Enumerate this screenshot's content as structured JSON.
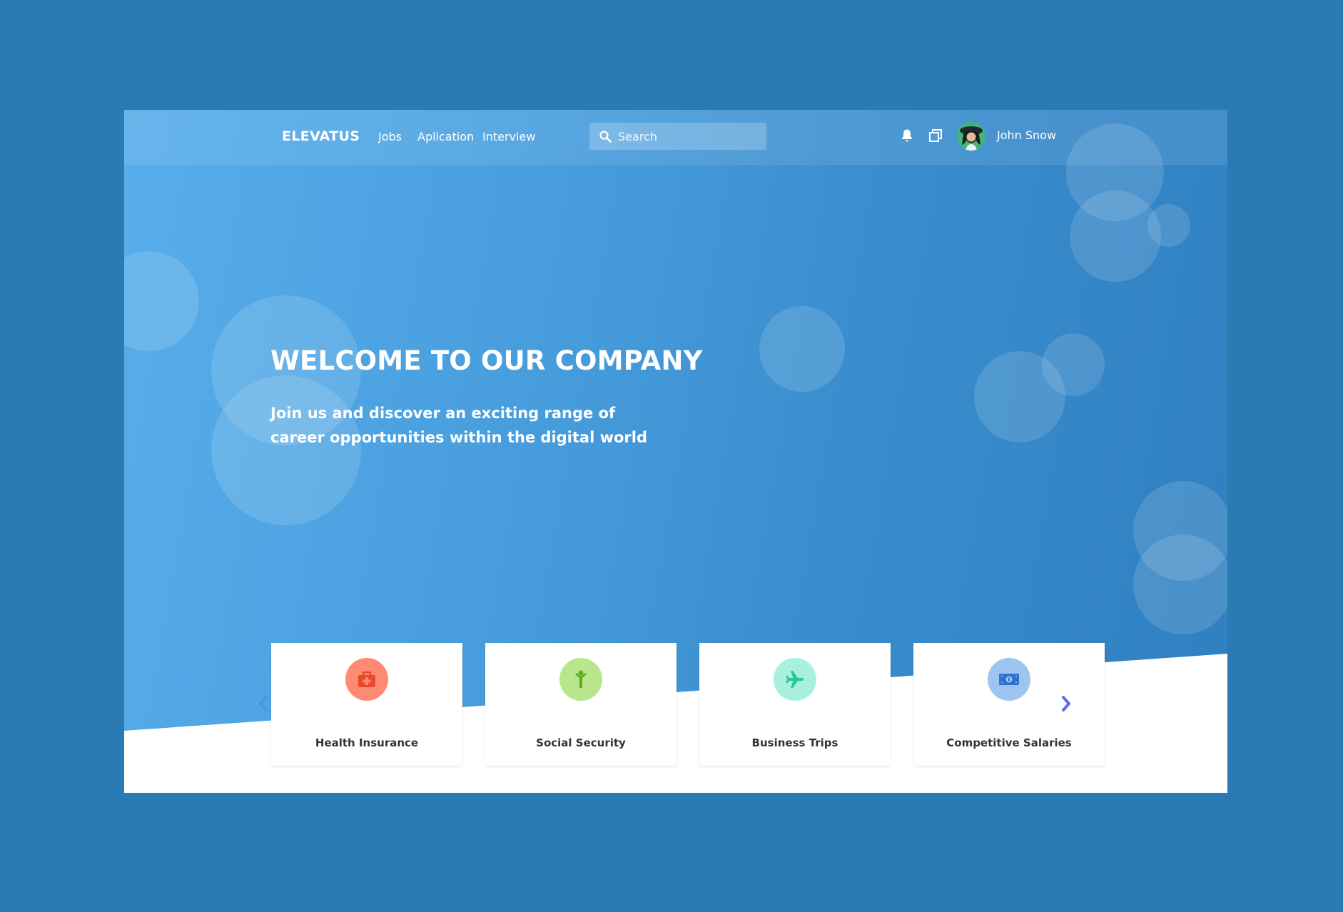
{
  "nav": {
    "logo": "ELEVATUS",
    "links": [
      "Jobs",
      "Aplication",
      "Interview"
    ],
    "search_placeholder": "Search",
    "user_name": "John Snow"
  },
  "hero": {
    "title": "WELCOME TO OUR COMPANY",
    "subtitle": "Join us and discover an exciting range of career opportunities within the digital world"
  },
  "benefits": [
    {
      "label": "Health Insurance",
      "icon": "first-aid-kit-icon",
      "color": "#ff8a73",
      "icon_color": "#e94a2c"
    },
    {
      "label": "Social Security",
      "icon": "person-icon",
      "color": "#b9e68c",
      "icon_color": "#5fae1e"
    },
    {
      "label": "Business Trips",
      "icon": "airplane-icon",
      "color": "#a8f0de",
      "icon_color": "#2fc39c"
    },
    {
      "label": "Competitive Salaries",
      "icon": "banknote-icon",
      "color": "#9ec5f2",
      "icon_color": "#2a73d0"
    }
  ],
  "colors": {
    "page_background": "#2a7ab3",
    "hero_gradient_start": "#58aeea",
    "hero_gradient_end": "#2f7fc1",
    "carousel_arrow": "#5a6ee8"
  }
}
